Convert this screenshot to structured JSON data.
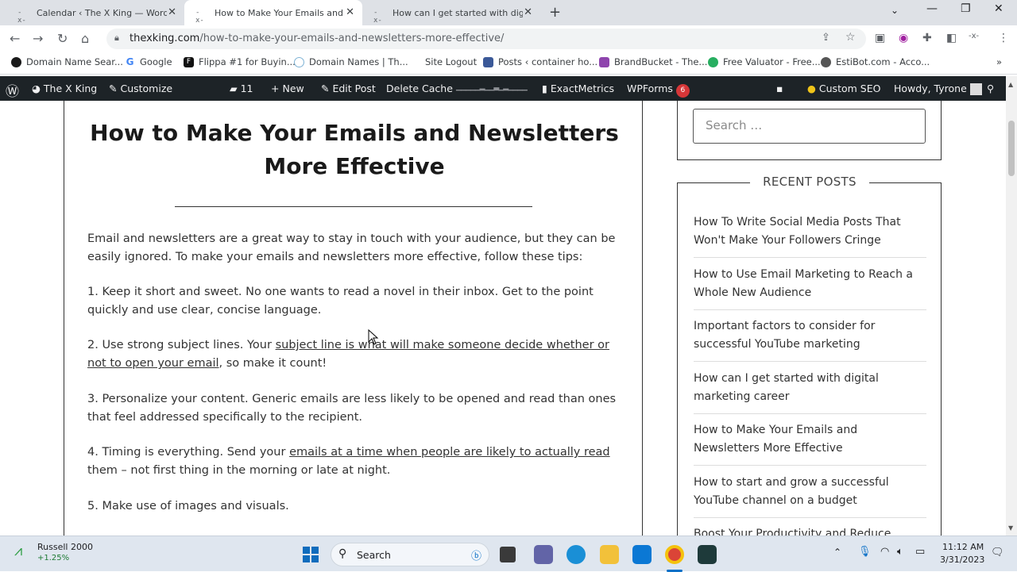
{
  "browser": {
    "tabs": [
      {
        "label": "Calendar ‹ The X King — WordPress",
        "active": false
      },
      {
        "label": "How to Make Your Emails and Newsletters More Effective",
        "active": true
      },
      {
        "label": "How can I get started with digital marketing career",
        "active": false
      }
    ],
    "url_domain": "thexking.com",
    "url_path": "/how-to-make-your-emails-and-newsletters-more-effective/"
  },
  "bookmarks": [
    {
      "label": "Domain Name Sear...",
      "color": "#c0392b"
    },
    {
      "label": "Google",
      "color": "#4285f4"
    },
    {
      "label": "Flippa #1 for Buyin...",
      "color": "#111111"
    },
    {
      "label": "Domain Names | Th...",
      "color": "#7fb3d5"
    },
    {
      "label": "Site Logout",
      "color": ""
    },
    {
      "label": "Posts ‹ container ho...",
      "color": "#3b5998"
    },
    {
      "label": "BrandBucket - The...",
      "color": "#8e44ad"
    },
    {
      "label": "Free Valuator - Free...",
      "color": "#27ae60"
    },
    {
      "label": "EstiBot.com - Acco...",
      "color": "#555555"
    }
  ],
  "wpbar": {
    "site": "The X King",
    "customize": "Customize",
    "comments": "11",
    "new": "New",
    "edit": "Edit Post",
    "cache": "Delete Cache",
    "metrics": "ExactMetrics",
    "forms": "WPForms",
    "forms_badge": "6",
    "seo": "Custom SEO",
    "howdy": "Howdy, Tyrone"
  },
  "article": {
    "title": "How to Make Your Emails and Newsletters More Effective",
    "p1": "Email and newsletters are a great way to stay in touch with your audience, but they can be easily ignored. To make your emails and newsletters more effective, follow these tips:",
    "p2": "1. Keep it short and sweet. No one wants to read a novel in their inbox. Get to the point quickly and use clear, concise language.",
    "p3_before": "2. Use strong subject lines. Your ",
    "p3_link": "subject line is what will make someone decide whether or not to open your email",
    "p3_after": ", so make it count!",
    "p4": "3. Personalize your content. Generic emails are less likely to be opened and read than ones that feel addressed specifically to the recipient.",
    "p5_before": "4. Timing is everything. Send your ",
    "p5_link": "emails at a time when people are likely to actually read",
    "p5_after": " them – not first thing in the morning or late at night.",
    "p6": "5. Make use of images and visuals."
  },
  "sidebar": {
    "search_placeholder": "Search …",
    "recent_heading": "RECENT POSTS",
    "recent": [
      "How To Write Social Media Posts That Won't Make Your Followers Cringe",
      "How to Use Email Marketing to Reach a Whole New Audience",
      "Important factors to consider for successful YouTube marketing",
      "How can I get started with digital marketing career",
      "How to Make Your Emails and Newsletters More Effective",
      "How to start and grow a successful YouTube channel on a budget",
      "Boost Your Productivity and Reduce Stress"
    ]
  },
  "taskbar": {
    "stock_name": "Russell 2000",
    "stock_change": "+1.25%",
    "search": "Search",
    "time": "11:12 AM",
    "date": "3/31/2023"
  }
}
